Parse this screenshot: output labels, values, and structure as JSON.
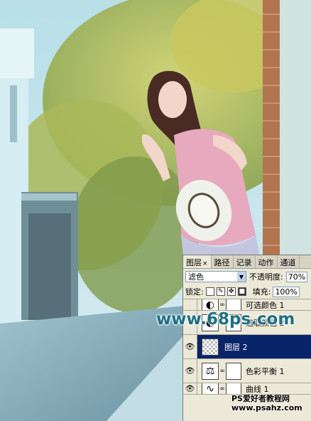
{
  "panel": {
    "tabs": [
      {
        "label": "图层",
        "close": "×"
      },
      {
        "label": "路径"
      },
      {
        "label": "记录"
      },
      {
        "label": "动作"
      },
      {
        "label": "通道"
      }
    ],
    "blend_mode": "滤色",
    "opacity_label": "不透明度:",
    "opacity_value": "70%",
    "lock_label": "锁定:",
    "fill_label": "填充:",
    "fill_value": "100%",
    "layers": [
      {
        "name": "可选颜色 1",
        "visible": false,
        "thumb_icon": "selective-color-icon",
        "partial": true
      },
      {
        "name": "选取颜色 2",
        "visible": false,
        "thumb_icon": "selective-color-icon"
      },
      {
        "name": "图层 2",
        "visible": true,
        "thumb_icon": "checker",
        "selected": true
      },
      {
        "name": "色彩平衡 1",
        "visible": true,
        "thumb_icon": "color-balance-icon"
      },
      {
        "name": "曲线 1",
        "visible": true,
        "thumb_icon": "curves-icon",
        "partial": true
      }
    ]
  },
  "watermark": {
    "site": "www.68ps.com",
    "forum_name": "PS爱好者教程网",
    "forum_url": "www.psahz.com"
  }
}
